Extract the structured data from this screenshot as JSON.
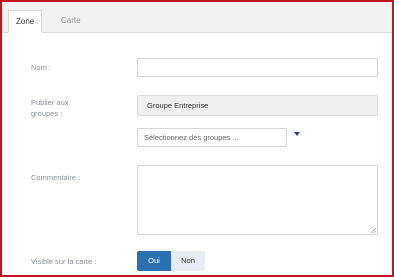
{
  "tabs": [
    {
      "label": "Zone",
      "active": true
    },
    {
      "label": "Carte",
      "active": false
    }
  ],
  "form": {
    "nom": {
      "label": "Nom :",
      "value": ""
    },
    "groupes": {
      "label_line1": "Publier aux",
      "label_line2": "groupes :",
      "selected": "Groupe Entreprise",
      "placeholder": "Sélectionnez des groupes ..."
    },
    "commentaire": {
      "label": "Commentaire :",
      "value": ""
    },
    "visible": {
      "label": "Visible sur la carte :",
      "on_label": "Oui",
      "off_label": "Non",
      "selected": "Oui"
    }
  },
  "colors": {
    "accent": "#2a6fb0",
    "frame": "#c0161c",
    "caret": "#2a3f8c"
  },
  "icons": {
    "dropdown": "caret-down-icon",
    "resize": "resize-handle-icon"
  }
}
